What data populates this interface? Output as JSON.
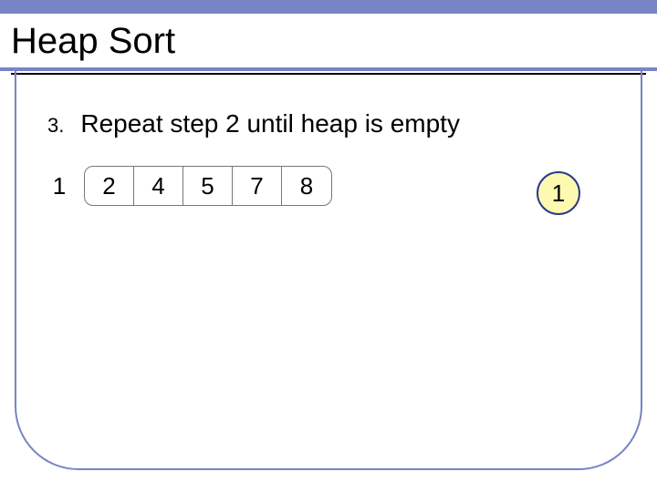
{
  "title": "Heap Sort",
  "step": {
    "number": "3.",
    "text": "Repeat step 2 until heap is empty"
  },
  "array": {
    "leading": "1",
    "cells": [
      "2",
      "4",
      "5",
      "7",
      "8"
    ]
  },
  "heap_node": "1"
}
